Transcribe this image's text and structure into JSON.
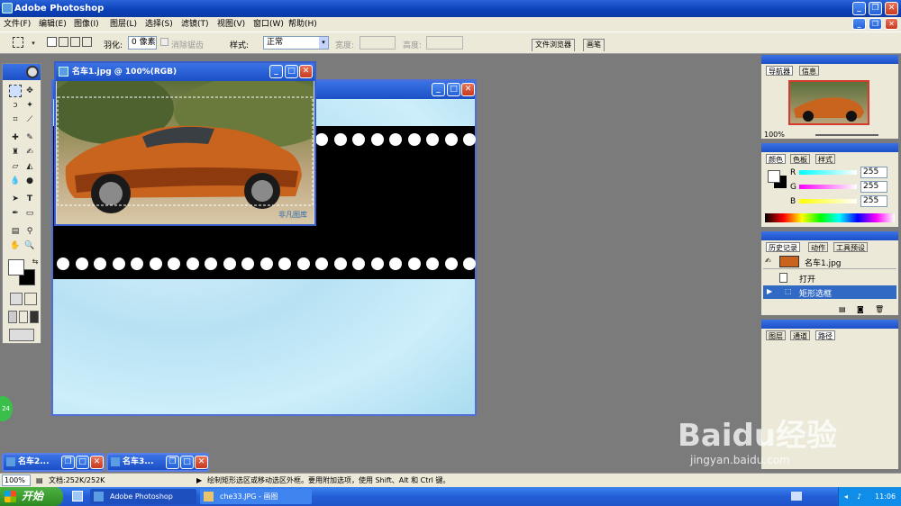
{
  "app": {
    "title": "Adobe Photoshop"
  },
  "menu": [
    "文件(F)",
    "编辑(E)",
    "图像(I)",
    "图层(L)",
    "选择(S)",
    "滤镜(T)",
    "视图(V)",
    "窗口(W)",
    "帮助(H)"
  ],
  "options": {
    "feather_label": "羽化:",
    "feather_value": "0 像素",
    "antialias_label": "消除锯齿",
    "style_label": "样式:",
    "style_value": "正常",
    "width_label": "宽度:",
    "height_label": "高度:",
    "file_browser": "文件浏览器",
    "brushes": "画笔"
  },
  "document_front": {
    "title": "名车1.jpg @ 100%(RGB)",
    "watermark": "非凡图库"
  },
  "minimized": [
    {
      "title": "名车2..."
    },
    {
      "title": "名车3..."
    }
  ],
  "navigator": {
    "tabs": [
      "导航器",
      "信息"
    ],
    "zoom": "100%"
  },
  "color_panel": {
    "tabs": [
      "颜色",
      "色板",
      "样式"
    ],
    "r_label": "R",
    "r": "255",
    "g_label": "G",
    "g": "255",
    "b_label": "B",
    "b": "255"
  },
  "history": {
    "tabs": [
      "历史记录",
      "动作",
      "工具预设"
    ],
    "snapshot": "名车1.jpg",
    "items": [
      "打开",
      "矩形选框"
    ]
  },
  "layers": {
    "tabs": [
      "图层",
      "通道",
      "路径"
    ]
  },
  "status": {
    "zoom": "100%",
    "doc": "文档:252K/252K",
    "hint": "绘制矩形选区或移动选区外框。要用附加选项，使用 Shift、Alt 和 Ctrl 键。"
  },
  "taskbar": {
    "start": "开始",
    "tasks": [
      "Adobe Photoshop",
      "che33.JPG - 画图"
    ],
    "clock": "11:06"
  },
  "overlay": {
    "brand": "Baidu经验",
    "url": "jingyan.baidu.com",
    "badge": "24"
  },
  "colors": {
    "xp_blue": "#1b4fc6",
    "panel_bg": "#ece9d8",
    "workspace": "#7b7b7b",
    "selection": "#316ac5"
  }
}
